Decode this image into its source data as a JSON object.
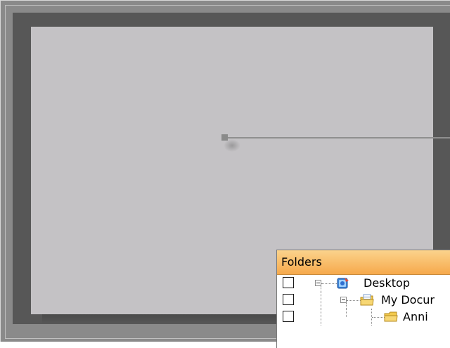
{
  "folders_panel": {
    "title": "Folders",
    "items": [
      {
        "label": "Desktop",
        "checked": false,
        "expanded": true,
        "icon": "desktop-icon"
      },
      {
        "label": "My Docur",
        "checked": false,
        "expanded": true,
        "icon": "my-documents-icon"
      },
      {
        "label": "Anni",
        "checked": false,
        "expanded": false,
        "icon": "folder-icon"
      }
    ]
  },
  "colors": {
    "canvas": "#c4c2c5",
    "frame": "#575757",
    "header": "#f6a94c"
  }
}
